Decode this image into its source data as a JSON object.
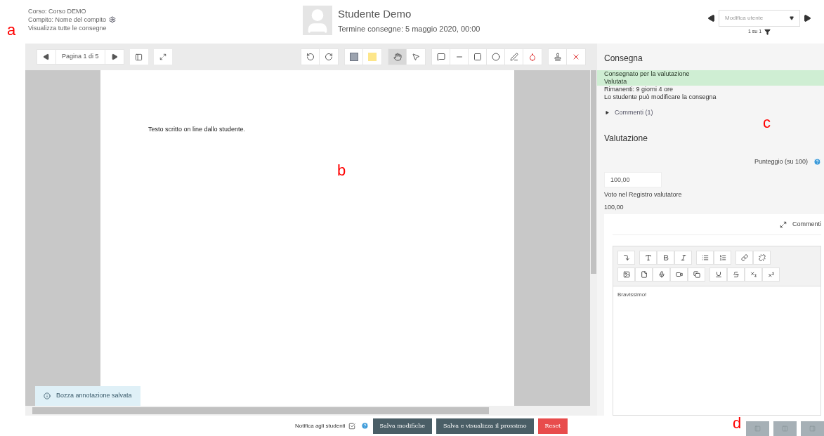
{
  "header": {
    "course": "Corso: Corso DEMO",
    "assignment": "Compito: Nome del compito",
    "view_all": "Visualizza tutte le consegne",
    "student_name": "Studente Demo",
    "due": "Termine consegne: 5 maggio 2020, 00:00",
    "user_select": {
      "placeholder": "Modifica utente"
    },
    "count": "1 su 1"
  },
  "annotator": {
    "page_label": "Pagina 1 di 5",
    "tools": [
      [
        {
          "kind": "rotate-left",
          "selected": false
        },
        {
          "kind": "rotate-right",
          "selected": false
        }
      ],
      [
        {
          "kind": "stamp-pick",
          "selected": false
        },
        {
          "kind": "color",
          "selected": false
        }
      ],
      [
        {
          "kind": "hand",
          "selected": true
        },
        {
          "kind": "pointer",
          "selected": false
        }
      ],
      [
        {
          "kind": "comment",
          "selected": false
        },
        {
          "kind": "line",
          "selected": false
        },
        {
          "kind": "rectangle",
          "selected": false
        },
        {
          "kind": "oval",
          "selected": false
        },
        {
          "kind": "pen",
          "selected": false
        },
        {
          "kind": "highlight",
          "selected": false
        }
      ],
      [
        {
          "kind": "stamp",
          "selected": false
        },
        {
          "kind": "delete",
          "selected": false
        }
      ]
    ],
    "document_text": "Testo scritto on line dallo studente.",
    "toast": "Bozza annotazione salvata"
  },
  "panel": {
    "submission_title": "Consegna",
    "status_lines": [
      "Consegnato per la valutazione",
      "Valutata"
    ],
    "info_lines": [
      "Rimanenti: 9 giorni 4 ore",
      "Lo studente può modificare la consegna"
    ],
    "comments_toggle": {
      "label": "Commenti (1)",
      "expanded": false
    },
    "grade_title": "Valutazione",
    "score_label": "Punteggio (su 100)",
    "score_value": "100,00",
    "gradebook_label": "Voto nel Registro valutatore",
    "gradebook_value": "100,00",
    "feedback_label": "Commenti",
    "editor_rows": [
      [
        [
          {
            "kind": "collapse"
          }
        ],
        [
          {
            "kind": "font"
          },
          {
            "kind": "bold"
          },
          {
            "kind": "italic"
          }
        ],
        [
          {
            "kind": "bullets"
          },
          {
            "kind": "numbers"
          }
        ],
        [
          {
            "kind": "link"
          },
          {
            "kind": "unlink"
          }
        ]
      ],
      [
        [
          {
            "kind": "image"
          },
          {
            "kind": "file"
          },
          {
            "kind": "mic"
          },
          {
            "kind": "video"
          },
          {
            "kind": "copy"
          }
        ],
        [
          {
            "kind": "underline"
          },
          {
            "kind": "strike"
          },
          {
            "kind": "subscript"
          },
          {
            "kind": "superscript"
          }
        ]
      ]
    ],
    "feedback_text": "Bravissimo!"
  },
  "footer": {
    "notify_label": "Notifica agli studenti",
    "notify_checked": true,
    "buttons": [
      {
        "label": "Salva modifiche",
        "kind": "primary"
      },
      {
        "label": "Salva e visualizza il prossimo",
        "kind": "primary"
      },
      {
        "label": "Reset",
        "kind": "danger"
      }
    ]
  },
  "markers": [
    "a",
    "b",
    "c",
    "d"
  ]
}
